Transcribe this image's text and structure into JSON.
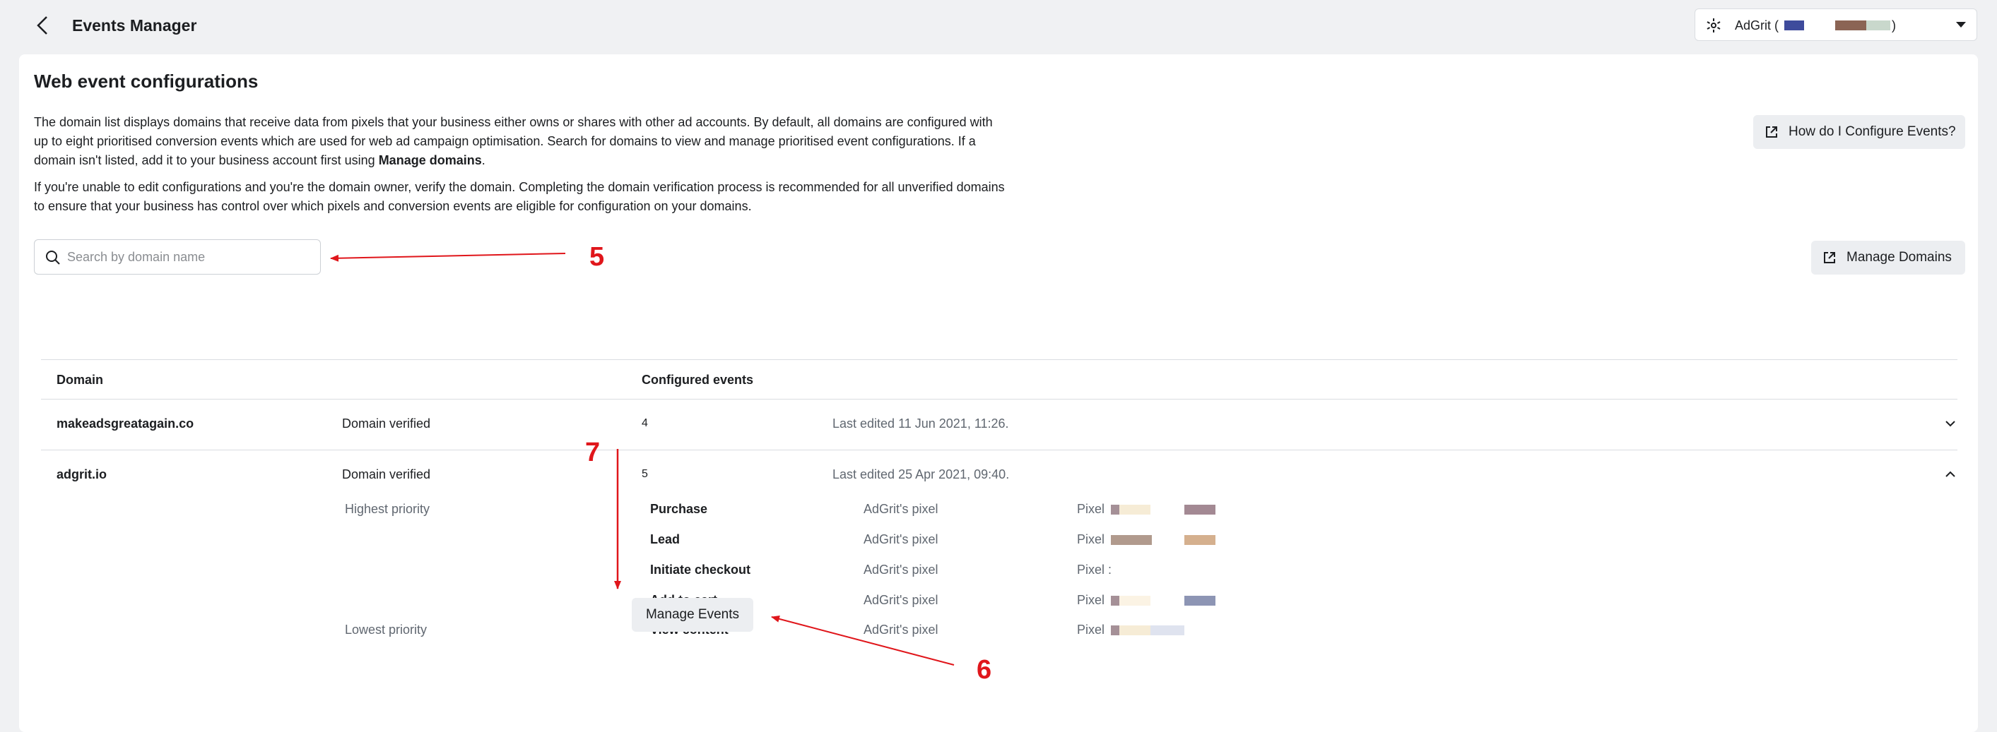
{
  "header": {
    "title": "Events Manager",
    "account_name": "AdGrit (",
    "account_close": ")"
  },
  "page": {
    "title": "Web event configurations",
    "desc1_part1": "The domain list displays domains that receive data from pixels that your business either owns or shares with other ad accounts. By default, all domains are configured with up to eight prioritised conversion events which are used for web ad campaign optimisation. Search for domains to view and manage prioritised event configurations. If a domain isn't listed, add it to your business account first using ",
    "desc1_bold": "Manage domains",
    "desc1_end": ".",
    "desc2": "If you're unable to edit configurations and you're the domain owner, verify the domain. Completing the domain verification process is recommended for all unverified domains to ensure that your business has control over which pixels and conversion events are eligible for configuration on your domains.",
    "how_button": "How do I Configure Events?",
    "manage_domains_button": "Manage Domains"
  },
  "search": {
    "placeholder": "Search by domain name",
    "value": ""
  },
  "table": {
    "headers": {
      "domain": "Domain",
      "configured": "Configured events"
    },
    "rows": [
      {
        "domain": "makeadsgreatagain.co",
        "status": "Domain verified",
        "count": "4",
        "edited": "Last edited 11 Jun 2021, 11:26."
      },
      {
        "domain": "adgrit.io",
        "status": "Domain verified",
        "count": "5",
        "edited": "Last edited 25 Apr 2021, 09:40."
      }
    ]
  },
  "expanded": {
    "highest_label": "Highest priority",
    "lowest_label": "Lowest priority",
    "events": [
      {
        "name": "Purchase",
        "source": "AdGrit's pixel",
        "pixel": "Pixel"
      },
      {
        "name": "Lead",
        "source": "AdGrit's pixel",
        "pixel": "Pixel"
      },
      {
        "name": "Initiate checkout",
        "source": "AdGrit's pixel",
        "pixel": "Pixel :"
      },
      {
        "name": "Add to cart",
        "source": "AdGrit's pixel",
        "pixel": "Pixel"
      },
      {
        "name": "View content",
        "source": "AdGrit's pixel",
        "pixel": "Pixel"
      }
    ],
    "manage_events_button": "Manage Events"
  },
  "annotations": {
    "search": "5",
    "manage": "6",
    "priority": "7"
  },
  "colors": {
    "annotation": "#e0161b",
    "button_bg": "#eceef1",
    "page_bg": "#f0f1f3"
  }
}
